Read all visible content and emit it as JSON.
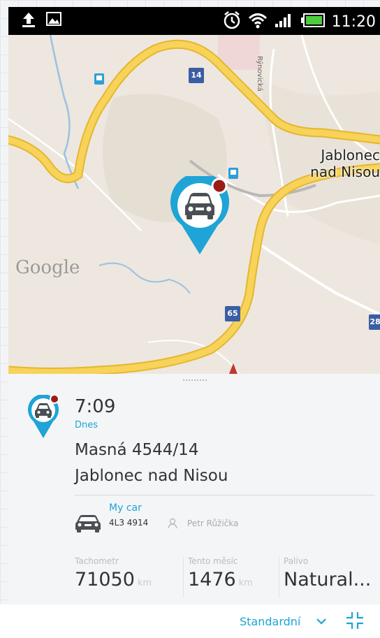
{
  "status_bar": {
    "time": "11:20",
    "icons": [
      "upload-icon",
      "image-icon",
      "alarm-icon",
      "wifi-icon",
      "signal-icon",
      "battery-icon"
    ]
  },
  "map": {
    "city_label_line1": "Jablonec",
    "city_label_line2": "nad Nisou",
    "google_logo": "Google",
    "street_label": "Rýnovická",
    "road_shields": [
      "14",
      "65",
      "28"
    ],
    "colors": {
      "road": "#f5c842",
      "water": "#9cc0e4",
      "marker": "#1ea4d6",
      "alert_dot": "#9b1b1b"
    }
  },
  "card": {
    "time": "7:09",
    "day": "Dnes",
    "address_line1": "Masná 4544/14",
    "address_line2": "Jablonec nad Nisou",
    "car_name": "My car",
    "plate": "4L3 4914",
    "driver": "Petr Růžička",
    "stats": [
      {
        "label": "Tachometr",
        "value": "71050",
        "unit": "km"
      },
      {
        "label": "Tento měsíc",
        "value": "1476",
        "unit": "km"
      },
      {
        "label": "Palivo",
        "value": "Natural...",
        "unit": ""
      }
    ]
  },
  "bottom_bar": {
    "mode_label": "Standardní"
  }
}
